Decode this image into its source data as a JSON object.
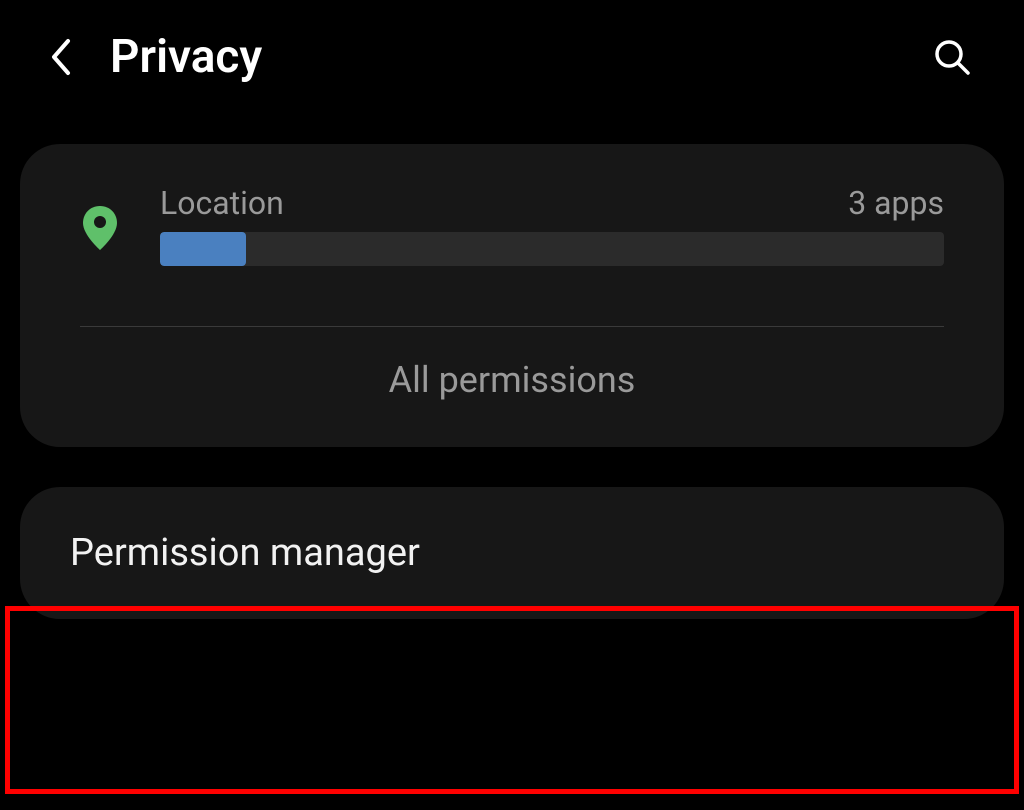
{
  "header": {
    "title": "Privacy"
  },
  "card": {
    "permission": {
      "label": "Location",
      "count_label": "3 apps",
      "fill_percent": 11
    },
    "all_permissions_label": "All permissions"
  },
  "list": {
    "permission_manager_label": "Permission manager"
  },
  "colors": {
    "accent_bar": "#4a80c0",
    "location_icon": "#5fc06a",
    "highlight": "#ff0000"
  }
}
